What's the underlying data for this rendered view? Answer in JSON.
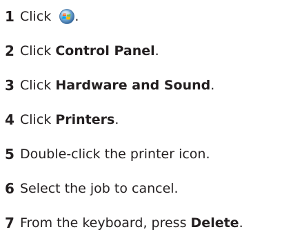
{
  "steps": [
    {
      "number": "1",
      "pre": "Click ",
      "bold": "",
      "post": ".",
      "icon": "windows-start-orb-icon"
    },
    {
      "number": "2",
      "pre": "Click ",
      "bold": "Control Panel",
      "post": "."
    },
    {
      "number": "3",
      "pre": "Click ",
      "bold": "Hardware and Sound",
      "post": "."
    },
    {
      "number": "4",
      "pre": "Click ",
      "bold": "Printers",
      "post": "."
    },
    {
      "number": "5",
      "pre": "Double-click the printer icon.",
      "bold": "",
      "post": ""
    },
    {
      "number": "6",
      "pre": "Select the job to cancel.",
      "bold": "",
      "post": ""
    },
    {
      "number": "7",
      "pre": "From the keyboard, press ",
      "bold": "Delete",
      "post": "."
    }
  ],
  "colors": {
    "text": "#231f20"
  }
}
